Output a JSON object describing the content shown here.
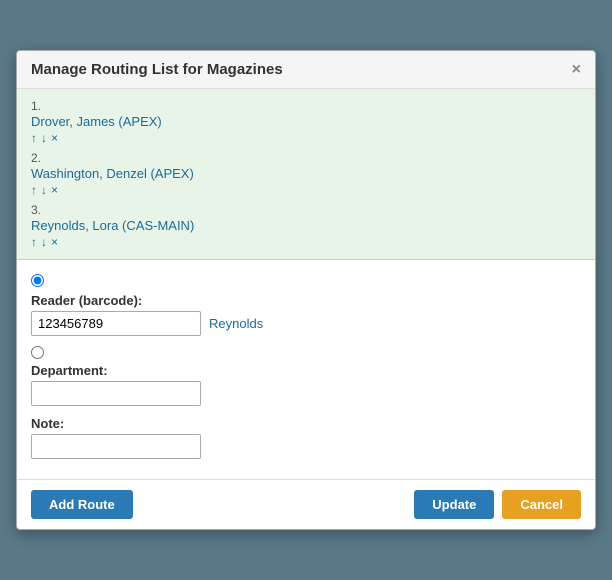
{
  "modal": {
    "title": "Manage Routing List for Magazines",
    "close_label": "×"
  },
  "routing_list": {
    "items": [
      {
        "number": "1.",
        "name": "Drover, James (APEX)",
        "up": "↑",
        "down": "↓",
        "remove": "×"
      },
      {
        "number": "2.",
        "name": "Washington, Denzel (APEX)",
        "up": "↑",
        "down": "↓",
        "remove": "×"
      },
      {
        "number": "3.",
        "name": "Reynolds, Lora (CAS-MAIN)",
        "up": "↑",
        "down": "↓",
        "remove": "×"
      }
    ]
  },
  "form": {
    "reader_label": "Reader (barcode):",
    "reader_value": "123456789",
    "reader_resolved": "Reynolds",
    "department_label": "Department:",
    "department_value": "",
    "note_label": "Note:",
    "note_value": ""
  },
  "footer": {
    "add_route_label": "Add Route",
    "update_label": "Update",
    "cancel_label": "Cancel"
  }
}
